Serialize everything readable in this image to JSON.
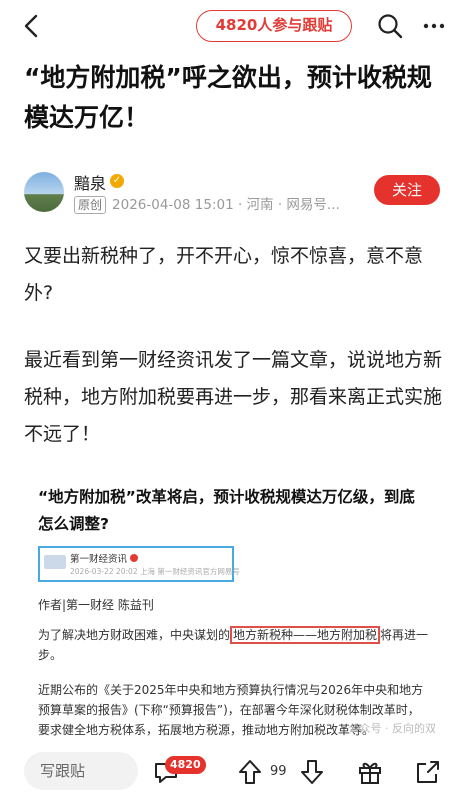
{
  "header": {
    "participants": "4820人参与跟贴",
    "back_icon": "back-arrow-icon",
    "search_icon": "search-icon",
    "more_icon": "more-dots-icon"
  },
  "article": {
    "title": "“地方附加税”呼之欲出，预计收税规模达万亿！",
    "author": {
      "name": "黯泉",
      "badge": "原创",
      "meta": "2026-04-08 15:01 · 河南 · 网易号..."
    },
    "follow_label": "关注",
    "paragraphs": [
      "又要出新税种了，开不开心，惊不惊喜，意不意外?",
      "最近看到第一财经资讯发了一篇文章，说说地方新税种，地方附加税要再进一步，那看来离正式实施不远了！"
    ],
    "embed": {
      "title": "“地方附加税”改革将启，预计收税规模达万亿级，到底怎么调整?",
      "source_name": "第一财经资讯",
      "source_meta": "2026-03-22 20:02 上海 第一财经资讯官方网易号",
      "author_line": "作者|第一财经 陈益刊",
      "p1_before": "为了解决地方财政困难，中央谋划的",
      "p1_highlight": "地方新税种——地方附加税",
      "p1_after": "将再进一步。",
      "p2": "近期公布的《关于2025年中央和地方预算执行情况与2026年中央和地方预算草案的报告》(下称“预算报告”)，在部署今年深化财税体制改革时，要求健全地方税体系，拓展地方税源，推动地方附加税改革等。",
      "watermark": "公众号 · 反向的双"
    }
  },
  "bottom": {
    "write_placeholder": "写跟贴",
    "comment_count": "4820",
    "like_count": "99"
  },
  "colors": {
    "accent": "#e5322d",
    "highlight_box": "#4aa9e0"
  }
}
